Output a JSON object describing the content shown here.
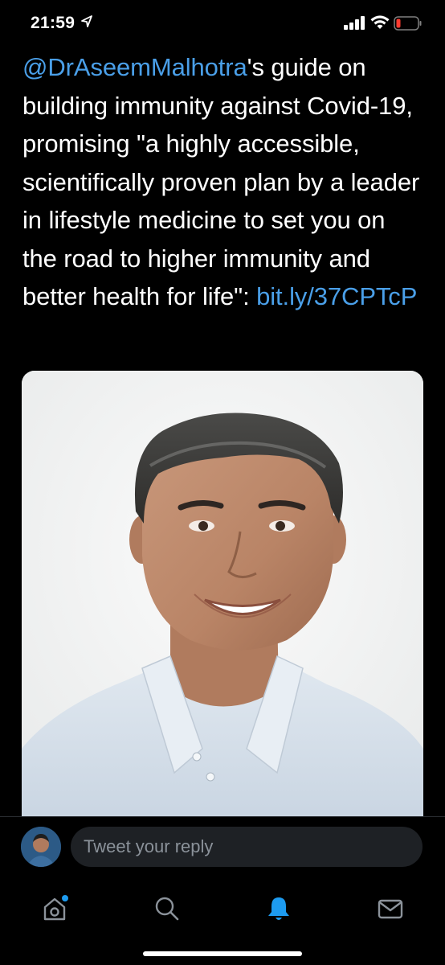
{
  "status_bar": {
    "time": "21:59",
    "icons": [
      "location-arrow-icon",
      "cellular-signal-icon",
      "wifi-icon",
      "battery-low-icon"
    ],
    "battery_color": "#ff3b30"
  },
  "tweet": {
    "mention": "@DrAseemMalhotra",
    "text": "'s guide on building immunity against Covid-19, promising \"a highly accessible, scientifically proven plan by a leader in lifestyle medicine to set you on the road to higher immunity and better health for life\": ",
    "link": "bit.ly/37CPTcP",
    "link_color": "#4a9fe8",
    "image_subject": "portrait photo of a smiling man with short grey hair in a light blue shirt"
  },
  "reply": {
    "placeholder": "Tweet your reply"
  },
  "tab_bar": {
    "tabs": [
      {
        "icon": "home-icon",
        "active": false,
        "has_dot": true
      },
      {
        "icon": "search-icon",
        "active": false
      },
      {
        "icon": "notifications-bell-icon",
        "active": true
      },
      {
        "icon": "messages-icon",
        "active": false
      }
    ],
    "accent": "#1d9bf0"
  }
}
